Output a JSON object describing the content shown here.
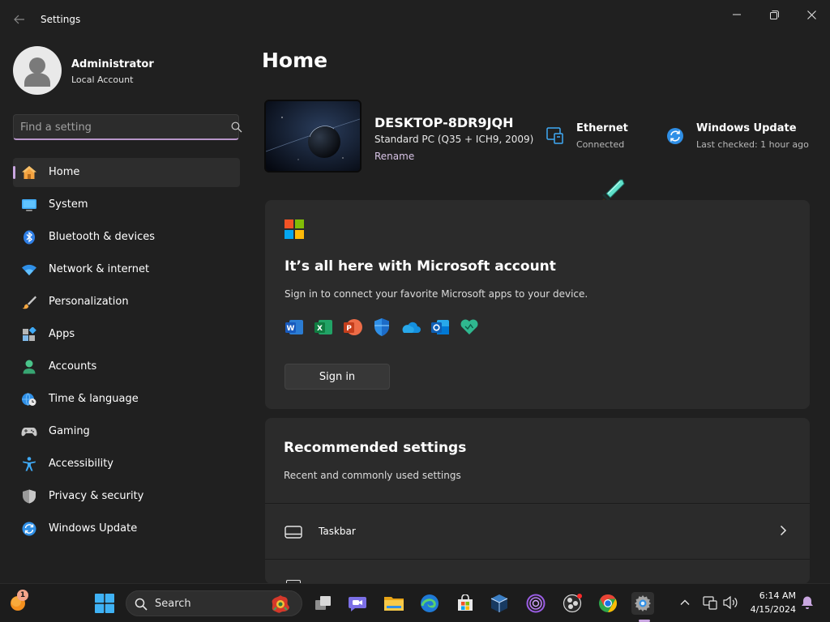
{
  "window": {
    "title": "Settings",
    "back_icon": "arrow-left-icon",
    "minimize_icon": "minimize-icon",
    "maximize_icon": "maximize-icon",
    "close_icon": "close-icon"
  },
  "user": {
    "name": "Administrator",
    "account_type": "Local Account",
    "avatar_icon": "user-avatar-icon"
  },
  "search": {
    "placeholder": "Find a setting",
    "value": "",
    "icon": "search-icon"
  },
  "nav": {
    "items": [
      {
        "label": "Home",
        "icon": "home-icon",
        "active": true
      },
      {
        "label": "System",
        "icon": "monitor-icon"
      },
      {
        "label": "Bluetooth & devices",
        "icon": "bluetooth-icon"
      },
      {
        "label": "Network & internet",
        "icon": "wifi-icon"
      },
      {
        "label": "Personalization",
        "icon": "brush-icon"
      },
      {
        "label": "Apps",
        "icon": "apps-icon"
      },
      {
        "label": "Accounts",
        "icon": "person-icon"
      },
      {
        "label": "Time & language",
        "icon": "globe-clock-icon"
      },
      {
        "label": "Gaming",
        "icon": "gamepad-icon"
      },
      {
        "label": "Accessibility",
        "icon": "accessibility-icon"
      },
      {
        "label": "Privacy & security",
        "icon": "shield-icon"
      },
      {
        "label": "Windows Update",
        "icon": "sync-icon"
      }
    ]
  },
  "main": {
    "title": "Home",
    "device": {
      "name": "DESKTOP-8DR9JQH",
      "model": "Standard PC (Q35 + ICH9, 2009)",
      "rename": "Rename"
    },
    "ethernet": {
      "title": "Ethernet",
      "status": "Connected",
      "icon": "ethernet-icon"
    },
    "update": {
      "title": "Windows Update",
      "status": "Last checked: 1 hour ago",
      "icon": "sync-icon"
    },
    "ms_card": {
      "title": "It’s all here with Microsoft account",
      "subtitle": "Sign in to connect your favorite Microsoft apps to your device.",
      "button": "Sign in",
      "apps": [
        "word-icon",
        "excel-icon",
        "powerpoint-icon",
        "defender-icon",
        "onedrive-icon",
        "outlook-icon",
        "family-icon"
      ]
    },
    "recommended": {
      "title": "Recommended settings",
      "subtitle": "Recent and commonly used settings",
      "items": [
        {
          "label": "Taskbar",
          "icon": "taskbar-icon"
        }
      ]
    }
  },
  "taskbar": {
    "search_label": "Search",
    "notification_badge": "1",
    "time": "6:14 AM",
    "date": "4/15/2024",
    "apps": [
      "file-explorer-icon",
      "edge-icon",
      "store-icon",
      "virtualbox-icon",
      "tor-icon",
      "obs-icon",
      "chrome-icon",
      "settings-icon"
    ]
  },
  "colors": {
    "background": "#202020",
    "card": "#2b2b2b",
    "accent": "#c9a6e0",
    "taskbar": "#1c1c1c"
  }
}
